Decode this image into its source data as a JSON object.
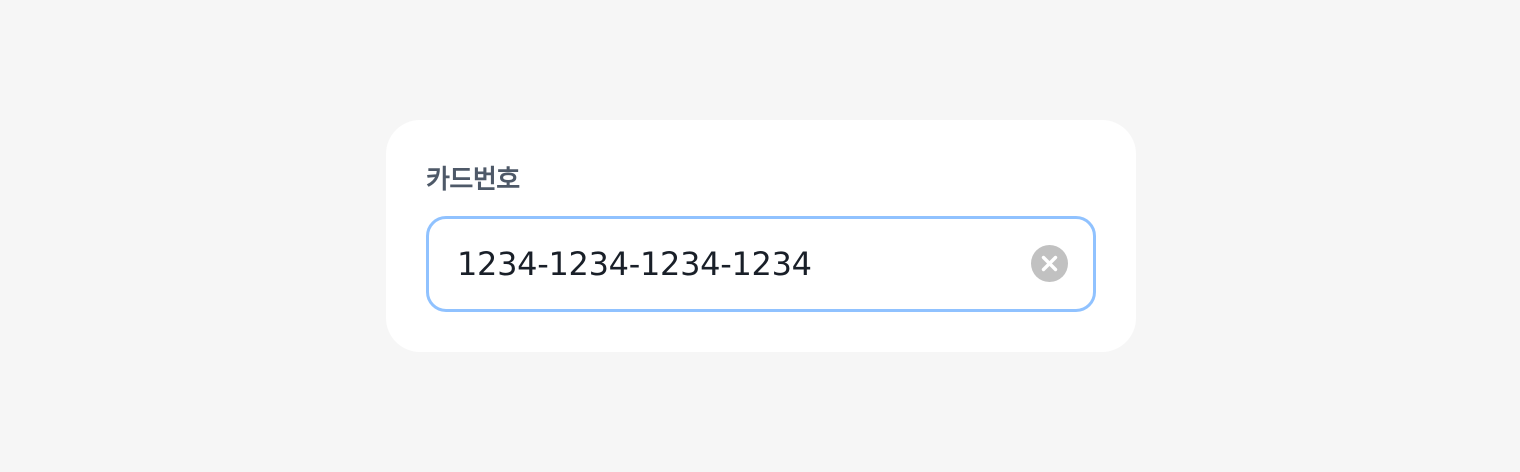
{
  "field": {
    "label": "카드번호",
    "value": "1234-1234-1234-1234",
    "focused": true
  },
  "icons": {
    "clear": "close-circle-icon"
  },
  "colors": {
    "page_background": "#f6f6f6",
    "card_background": "#ffffff",
    "focus_border": "#90c2ff",
    "label_text": "#4e5968",
    "value_text": "#191f28",
    "clear_button": "#c1c1c1"
  }
}
